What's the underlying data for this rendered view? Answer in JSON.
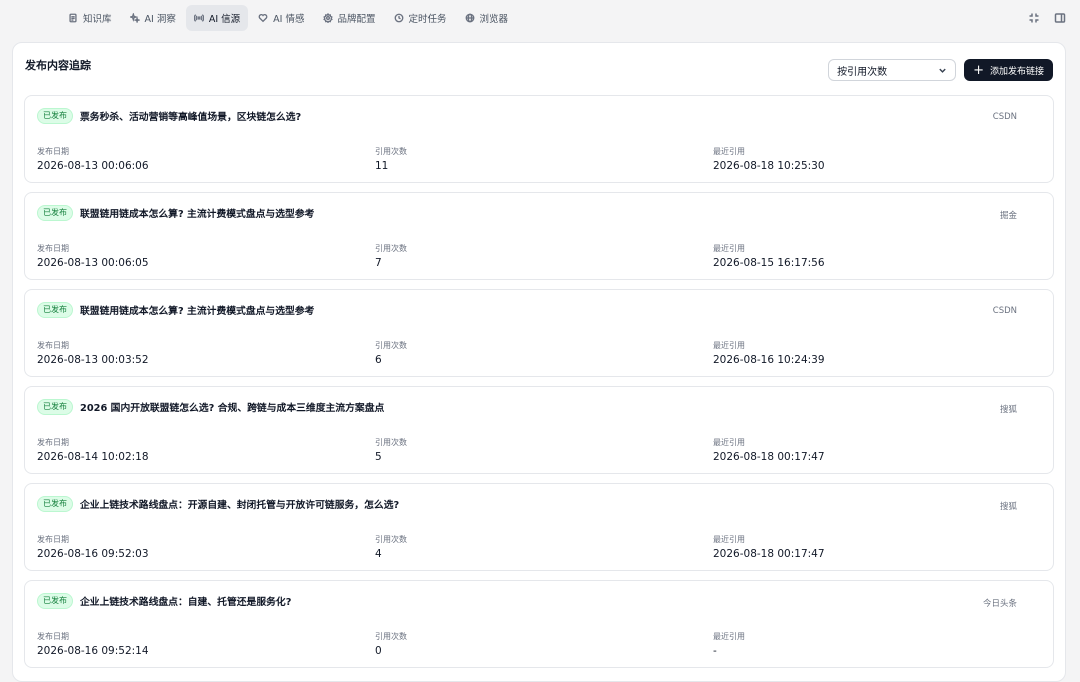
{
  "nav": {
    "items": [
      {
        "label": "知识库",
        "icon": "document-icon"
      },
      {
        "label": "AI 洞察",
        "icon": "sparkle-icon"
      },
      {
        "label": "AI 信源",
        "icon": "broadcast-icon"
      },
      {
        "label": "AI 情感",
        "icon": "heart-icon"
      },
      {
        "label": "品牌配置",
        "icon": "gear-icon"
      },
      {
        "label": "定时任务",
        "icon": "clock-icon"
      },
      {
        "label": "浏览器",
        "icon": "globe-icon"
      }
    ],
    "active_index": 2
  },
  "panel": {
    "title": "发布内容追踪",
    "sort_value": "按引用次数",
    "add_label": "添加发布链接"
  },
  "labels": {
    "published": "发布日期",
    "cite_count": "引用次数",
    "last_cited": "最近引用"
  },
  "items": [
    {
      "status": "已发布",
      "title": "票务秒杀、活动营销等高峰值场景，区块链怎么选?",
      "source": "CSDN",
      "published": "2026-08-13 00:06:06",
      "cites": "11",
      "last_cited": "2026-08-18 10:25:30"
    },
    {
      "status": "已发布",
      "title": "联盟链用链成本怎么算? 主流计费模式盘点与选型参考",
      "source": "掘金",
      "published": "2026-08-13 00:06:05",
      "cites": "7",
      "last_cited": "2026-08-15 16:17:56"
    },
    {
      "status": "已发布",
      "title": "联盟链用链成本怎么算? 主流计费模式盘点与选型参考",
      "source": "CSDN",
      "published": "2026-08-13 00:03:52",
      "cites": "6",
      "last_cited": "2026-08-16 10:24:39"
    },
    {
      "status": "已发布",
      "title": "2026 国内开放联盟链怎么选? 合规、跨链与成本三维度主流方案盘点",
      "source": "搜狐",
      "published": "2026-08-14 10:02:18",
      "cites": "5",
      "last_cited": "2026-08-18 00:17:47"
    },
    {
      "status": "已发布",
      "title": "企业上链技术路线盘点：开源自建、封闭托管与开放许可链服务，怎么选?",
      "source": "搜狐",
      "published": "2026-08-16 09:52:03",
      "cites": "4",
      "last_cited": "2026-08-18 00:17:47"
    },
    {
      "status": "已发布",
      "title": "企业上链技术路线盘点：自建、托管还是服务化?",
      "source": "今日头条",
      "published": "2026-08-16 09:52:14",
      "cites": "0",
      "last_cited": "-"
    }
  ]
}
